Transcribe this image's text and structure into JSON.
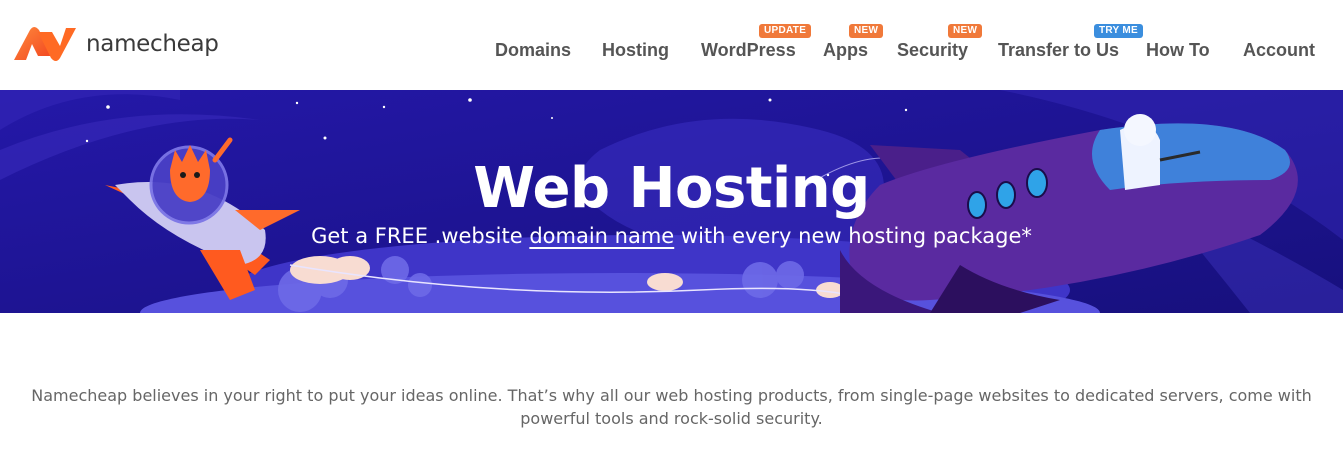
{
  "brand": {
    "name": "namecheap",
    "logo_color": "#ff5f1f"
  },
  "nav": {
    "items": [
      {
        "label": "Domains"
      },
      {
        "label": "Hosting"
      },
      {
        "label": "WordPress",
        "badge": "UPDATE"
      },
      {
        "label": "Apps",
        "badge": "NEW"
      },
      {
        "label": "Security",
        "badge": "NEW"
      },
      {
        "label": "Transfer to Us",
        "badge": "TRY ME"
      },
      {
        "label": "How To"
      },
      {
        "label": "Account"
      }
    ]
  },
  "hero": {
    "title": "Web Hosting",
    "subtitle_prefix": "Get a FREE .website ",
    "subtitle_link": "domain name",
    "subtitle_suffix": " with every new hosting package*",
    "background_color": "#1c1591"
  },
  "intro": {
    "line1": "Namecheap believes in your right to put your ideas online. That’s why all our web hosting products, from single-page websites to dedicated servers, come with",
    "line2": "powerful tools and rock-solid security."
  },
  "colors": {
    "badge_orange": "#f0793a",
    "badge_blue": "#3b8ede",
    "nav_text": "#555555"
  }
}
